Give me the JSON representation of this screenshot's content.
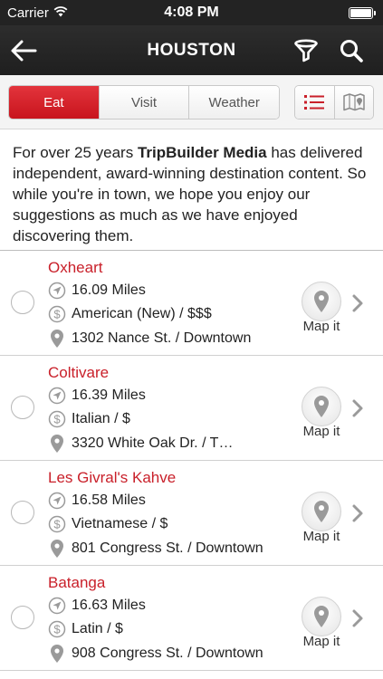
{
  "status_bar": {
    "carrier": "Carrier",
    "time": "4:08 PM"
  },
  "nav": {
    "title": "HOUSTON",
    "back_icon": "back-arrow-icon",
    "filter_icon": "filter-icon",
    "search_icon": "search-icon"
  },
  "segments": [
    {
      "label": "Eat",
      "active": true
    },
    {
      "label": "Visit",
      "active": false
    },
    {
      "label": "Weather",
      "active": false
    }
  ],
  "view_toggle": {
    "list_icon": "list-view-icon",
    "map_icon": "map-view-icon"
  },
  "intro": {
    "before": "For over 25 years ",
    "brand": "TripBuilder Media",
    "after": " has delivered independent, award-winning destination content.  So while you're in town, we hope you enjoy our suggestions as much as we have enjoyed discovering them."
  },
  "places": [
    {
      "name": "Oxheart",
      "distance": "16.09 Miles",
      "cuisine": "American (New) / $$$",
      "address": "1302 Nance St. / Downtown",
      "map_label": "Map it"
    },
    {
      "name": "Coltivare",
      "distance": "16.39 Miles",
      "cuisine": "Italian / $",
      "address": "3320 White Oak Dr. / T…",
      "map_label": "Map it"
    },
    {
      "name": "Les Givral's Kahve",
      "distance": "16.58 Miles",
      "cuisine": "Vietnamese / $",
      "address": "801 Congress St. / Downtown",
      "map_label": "Map it"
    },
    {
      "name": "Batanga",
      "distance": "16.63 Miles",
      "cuisine": "Latin / $",
      "address": "908 Congress St. / Downtown",
      "map_label": "Map it"
    }
  ],
  "colors": {
    "accent": "#c9202a",
    "nav_bg": "#262626",
    "icon_gray": "#9a9a9a"
  }
}
